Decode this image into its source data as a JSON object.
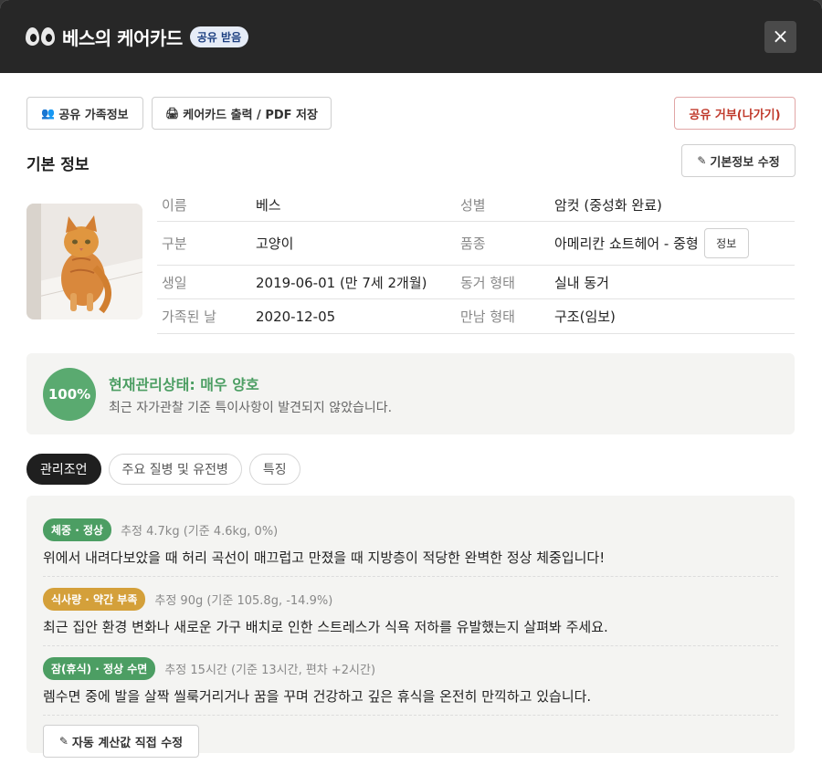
{
  "header": {
    "title": "베스의 케어카드",
    "badge": "공유 받음",
    "close_label": "×"
  },
  "toolbar": {
    "family_label": "공유 가족정보",
    "print_label": "케어카드 출력 / PDF 저장",
    "refuse_label": "공유 거부(나가기)"
  },
  "basic": {
    "section_title": "기본 정보",
    "edit_label": "기본정보 수정",
    "rows": [
      {
        "k1": "이름",
        "v1": "베스",
        "k2": "성별",
        "v2": "암컷 (중성화 완료)"
      },
      {
        "k1": "구분",
        "v1": "고양이",
        "k2": "품종",
        "v2": "아메리칸 쇼트헤어 - 중형"
      },
      {
        "k1": "생일",
        "v1": "2019-06-01 (만 7세 2개월)",
        "k2": "동거 형태",
        "v2": "실내 동거"
      },
      {
        "k1": "가족된 날",
        "v1": "2020-12-05",
        "k2": "만남 형태",
        "v2": "구조(임보)"
      }
    ],
    "breed_info_label": "정보"
  },
  "status": {
    "percent": "100%",
    "title": "현재관리상태: 매우 양호",
    "subtitle": "최근 자가관찰 기준 특이사항이 발견되지 않았습니다."
  },
  "tabs": [
    "관리조언",
    "주요 질병 및 유전병",
    "특징"
  ],
  "advice": [
    {
      "tag": "체중 · 정상",
      "color": "#4c9e63",
      "meta": "추정 4.7kg (기준 4.6kg, 0%)",
      "desc": "위에서 내려다보았을 때 허리 곡선이 매끄럽고 만졌을 때 지방층이 적당한 완벽한 정상 체중입니다!"
    },
    {
      "tag": "식사량 · 약간 부족",
      "color": "#d4a03a",
      "meta": "추정 90g (기준 105.8g, -14.9%)",
      "desc": "최근 집안 환경 변화나 새로운 가구 배치로 인한 스트레스가 식욕 저하를 유발했는지 살펴봐 주세요."
    },
    {
      "tag": "잠(휴식) · 정상 수면",
      "color": "#4c9e63",
      "meta": "추정 15시간 (기준 13시간, 편차 +2시간)",
      "desc": "렘수면 중에 발을 살짝 씰룩거리거나 꿈을 꾸며 건강하고 깊은 휴식을 온전히 만끽하고 있습니다."
    }
  ],
  "auto_edit_label": "자동 계산값 직접 수정"
}
